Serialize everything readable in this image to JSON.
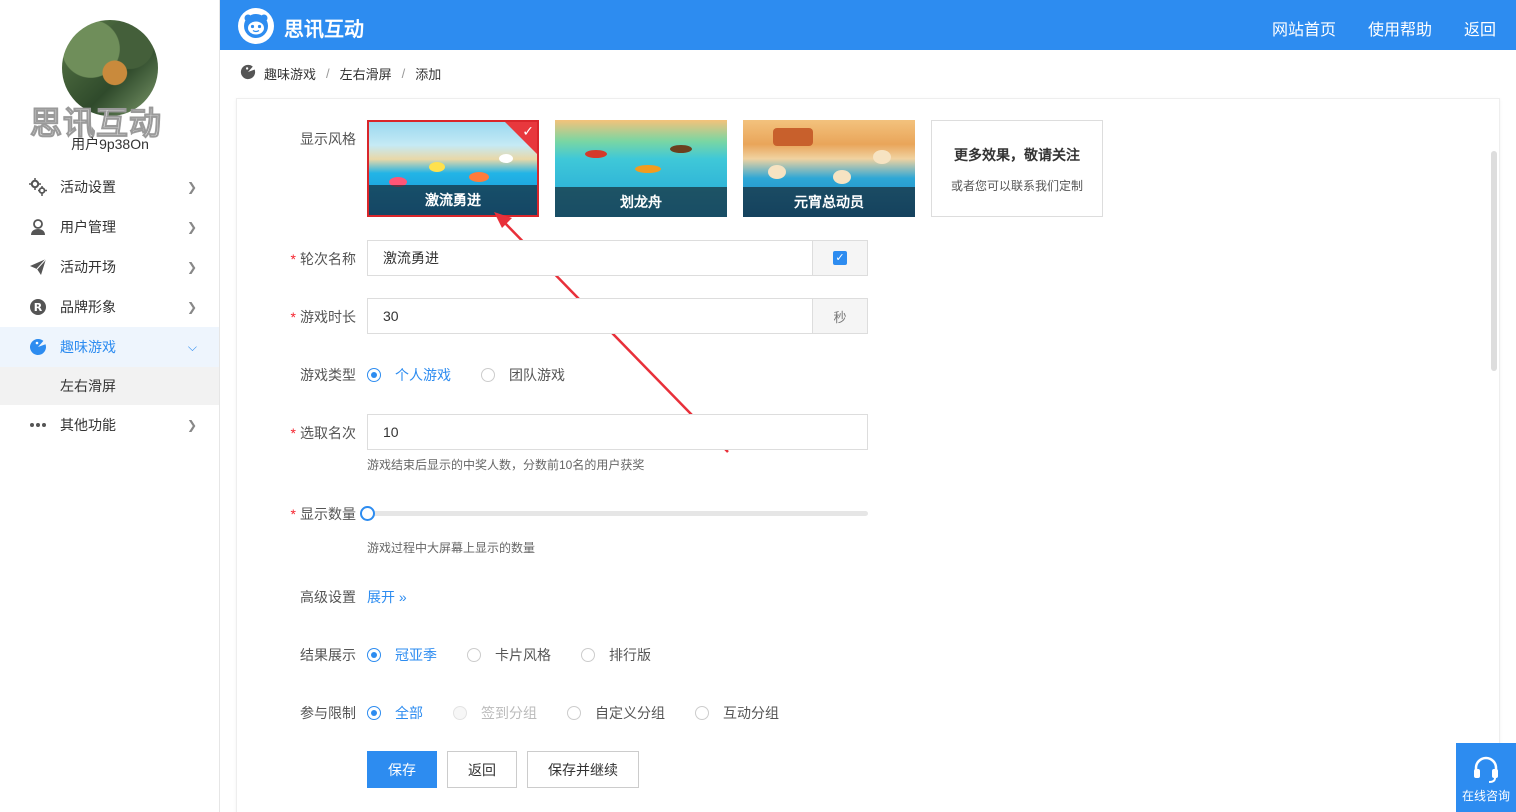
{
  "sidebar": {
    "watermark": "思讯互动",
    "username": "用户9p38On",
    "items": [
      {
        "label": "活动设置",
        "icon": "gears-icon"
      },
      {
        "label": "用户管理",
        "icon": "user-icon"
      },
      {
        "label": "活动开场",
        "icon": "paper-plane-icon"
      },
      {
        "label": "品牌形象",
        "icon": "registered-icon"
      },
      {
        "label": "趣味游戏",
        "icon": "game-icon"
      },
      {
        "label": "其他功能",
        "icon": "more-icon"
      }
    ],
    "sub_item": "左右滑屏"
  },
  "header": {
    "brand": "思讯互动",
    "nav": [
      "网站首页",
      "使用帮助",
      "返回"
    ]
  },
  "breadcrumb": [
    "趣味游戏",
    "左右滑屏",
    "添加"
  ],
  "form": {
    "style_label": "显示风格",
    "styles": [
      {
        "caption": "激流勇进",
        "selected": true
      },
      {
        "caption": "划龙舟",
        "selected": false
      },
      {
        "caption": "元宵总动员",
        "selected": false
      }
    ],
    "more_title": "更多效果，敬请关注",
    "more_sub": "或者您可以联系我们定制",
    "round_name_label": "轮次名称",
    "round_name_value": "激流勇进",
    "duration_label": "游戏时长",
    "duration_value": "30",
    "duration_unit": "秒",
    "game_type_label": "游戏类型",
    "game_types": [
      "个人游戏",
      "团队游戏"
    ],
    "rank_label": "选取名次",
    "rank_value": "10",
    "rank_hint": "游戏结束后显示的中奖人数，分数前10名的用户获奖",
    "display_count_label": "显示数量",
    "display_count_level": 0,
    "display_count_hint": "游戏过程中大屏幕上显示的数量",
    "advanced_label": "高级设置",
    "advanced_toggle": "展开",
    "result_label": "结果展示",
    "results": [
      "冠亚季",
      "卡片风格",
      "排行版"
    ],
    "limit_label": "参与限制",
    "limits": [
      "全部",
      "签到分组",
      "自定义分组",
      "互动分组"
    ],
    "save": "保存",
    "back": "返回",
    "save_continue": "保存并继续"
  },
  "chat": {
    "label": "在线咨询"
  },
  "colors": {
    "primary": "#2d8cf0",
    "selected_border": "#d9262b",
    "required": "#f5222d"
  }
}
